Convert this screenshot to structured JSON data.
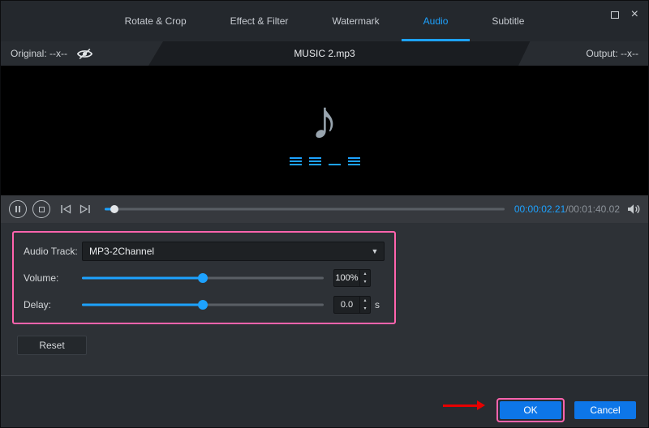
{
  "tabs": [
    {
      "label": "Rotate & Crop"
    },
    {
      "label": "Effect & Filter"
    },
    {
      "label": "Watermark"
    },
    {
      "label": "Audio"
    },
    {
      "label": "Subtitle"
    }
  ],
  "active_tab": "Audio",
  "window_controls": {
    "close_glyph": "×"
  },
  "preview_header": {
    "original": "Original: --x--",
    "filename": "MUSIC 2.mp3",
    "output": "Output: --x--"
  },
  "player": {
    "current_time": "00:00:02.21",
    "separator": "/",
    "total_time": "00:01:40.02"
  },
  "settings": {
    "audio_track": {
      "label": "Audio Track:",
      "value": "MP3-2Channel"
    },
    "volume": {
      "label": "Volume:",
      "value": "100%"
    },
    "delay": {
      "label": "Delay:",
      "value": "0.0",
      "unit": "s"
    }
  },
  "buttons": {
    "reset": "Reset",
    "ok": "OK",
    "cancel": "Cancel"
  },
  "icons": {
    "music_note": "♪",
    "dropdown_arrow": "▼",
    "spin_up": "▴",
    "spin_down": "▾"
  },
  "colors": {
    "accent_blue": "#1da2ff",
    "highlight_pink": "#ff63ad",
    "arrow_red": "#e60000",
    "button_blue": "#0d76e8"
  }
}
